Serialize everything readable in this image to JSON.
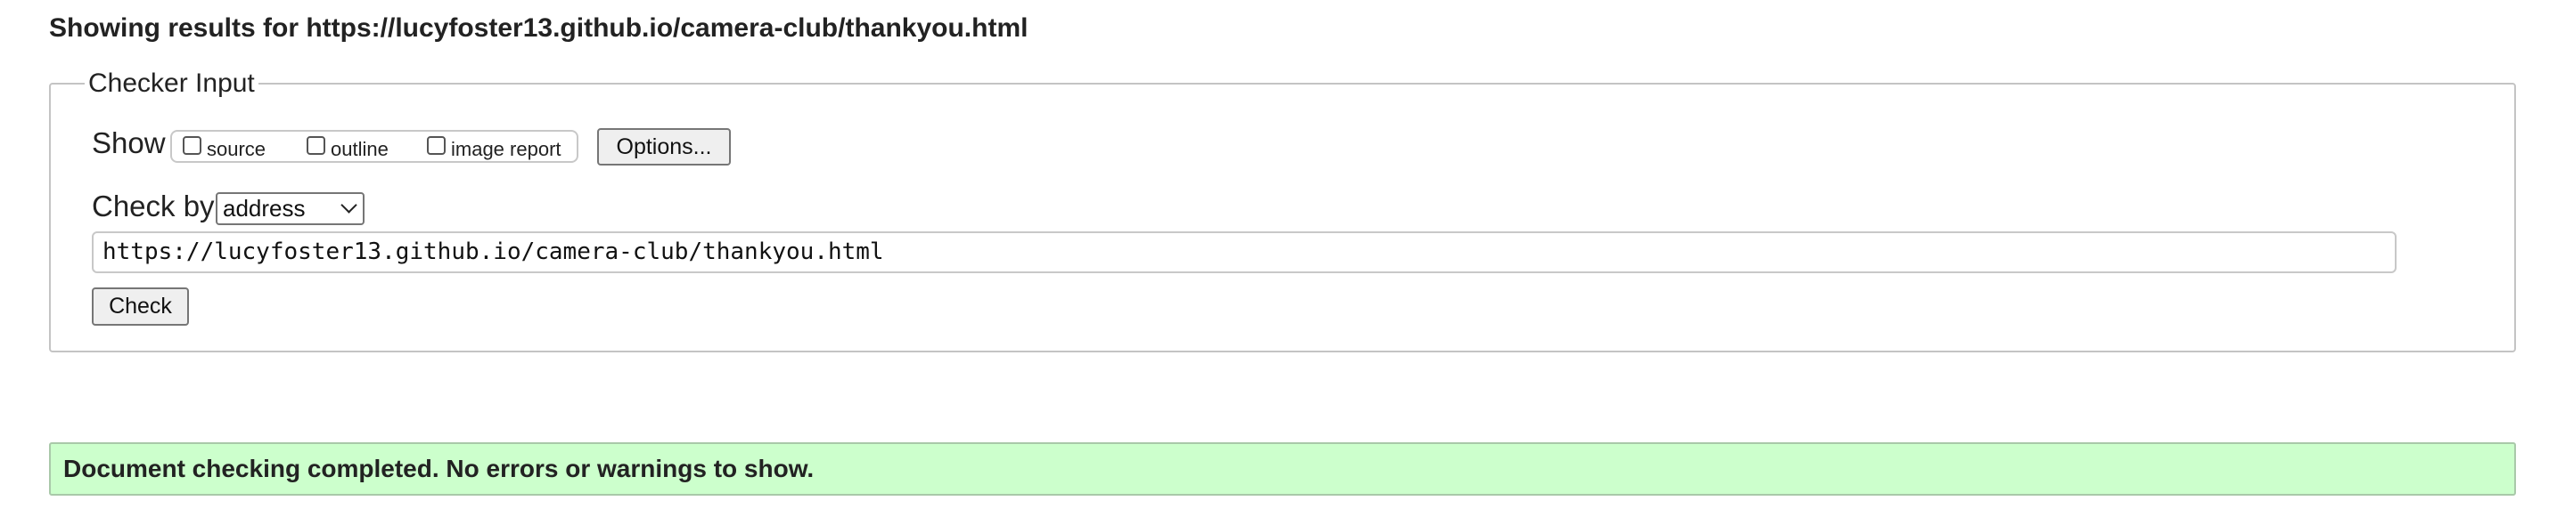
{
  "page": {
    "heading": "Showing results for https://lucyfoster13.github.io/camera-club/thankyou.html"
  },
  "checker_input": {
    "legend": "Checker Input",
    "show_label": "Show",
    "show_options": [
      {
        "label": "source",
        "checked": false
      },
      {
        "label": "outline",
        "checked": false
      },
      {
        "label": "image report",
        "checked": false
      }
    ],
    "options_button": "Options...",
    "check_by_label": "Check by",
    "check_by_selected": "address",
    "url_value": "https://lucyfoster13.github.io/camera-club/thankyou.html",
    "check_button": "Check"
  },
  "result": {
    "message": "Document checking completed. No errors or warnings to show."
  },
  "colors": {
    "success_background": "#ccffcc",
    "success_border": "#a9c9a9"
  }
}
